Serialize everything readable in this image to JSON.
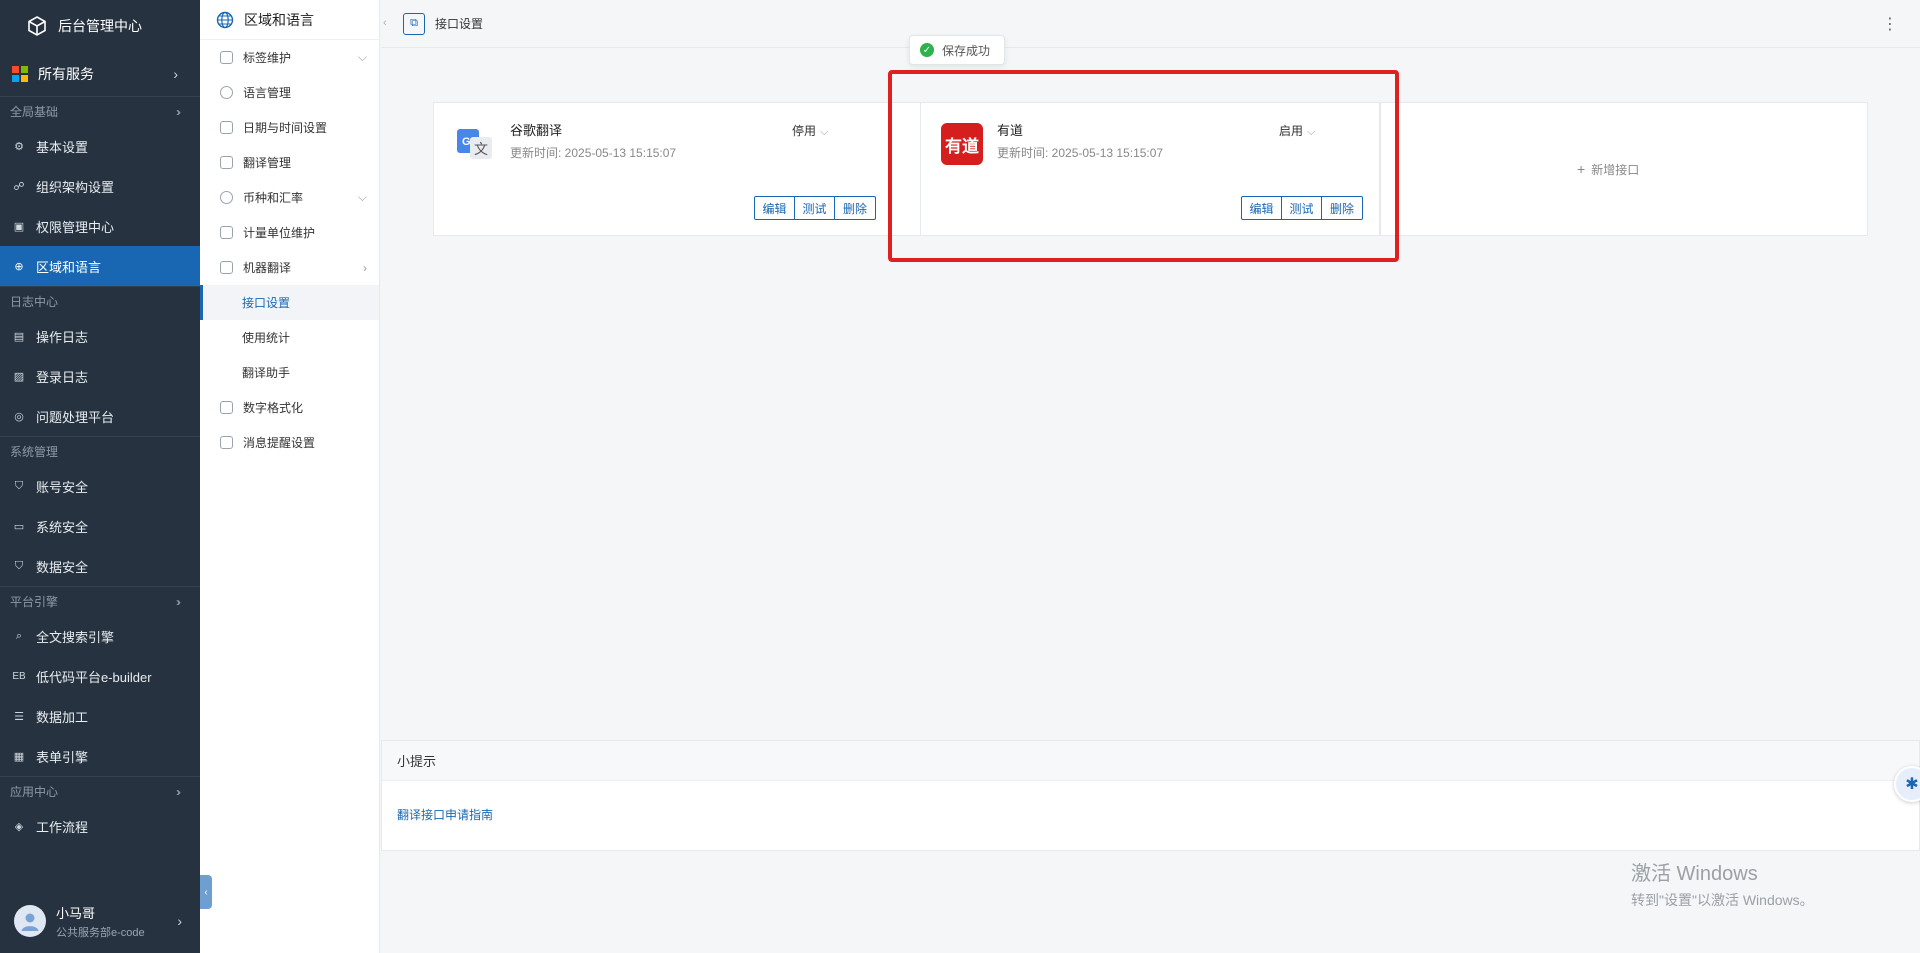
{
  "app": {
    "title": "后台管理中心"
  },
  "sidebar": {
    "all_services": "所有服务",
    "groups": [
      {
        "label": "全局基础",
        "items": [
          "基本设置",
          "组织架构设置",
          "权限管理中心",
          "区域和语言"
        ]
      },
      {
        "label": "日志中心",
        "items": [
          "操作日志",
          "登录日志",
          "问题处理平台"
        ]
      },
      {
        "label": "系统管理",
        "items": [
          "账号安全",
          "系统安全",
          "数据安全"
        ]
      },
      {
        "label": "平台引擎",
        "items": [
          "全文搜索引擎",
          "低代码平台e-builder",
          "数据加工",
          "表单引擎"
        ]
      },
      {
        "label": "应用中心",
        "items": [
          "工作流程"
        ]
      }
    ],
    "active_item": "区域和语言",
    "eb_prefix": "EB",
    "user": {
      "name": "小马哥",
      "dept": "公共服务部e-code"
    }
  },
  "submenu": {
    "title": "区域和语言",
    "items": [
      "标签维护",
      "语言管理",
      "日期与时间设置",
      "翻译管理",
      "币种和汇率",
      "计量单位维护",
      "机器翻译"
    ],
    "children": [
      "接口设置",
      "使用统计",
      "翻译助手"
    ],
    "tail": [
      "数字格式化",
      "消息提醒设置"
    ],
    "selected": "接口设置"
  },
  "topbar": {
    "title": "接口设置"
  },
  "toast": {
    "text": "保存成功"
  },
  "cards": [
    {
      "name": "谷歌翻译",
      "updated": "更新时间: 2025-05-13 15:15:07",
      "status": "停用",
      "actions": [
        "编辑",
        "测试",
        "删除"
      ]
    },
    {
      "name": "有道",
      "updated": "更新时间: 2025-05-13 15:15:07",
      "status": "启用",
      "logo_text": "有道",
      "actions": [
        "编辑",
        "测试",
        "删除"
      ]
    }
  ],
  "add_interface": "新增接口",
  "tips": {
    "title": "小提示",
    "link": "翻译接口申请指南"
  },
  "watermark": {
    "line1": "激活 Windows",
    "line2": "转到\"设置\"以激活 Windows。"
  },
  "colors": {
    "sidebar_bg": "#26323f",
    "accent": "#1967b2",
    "highlight": "#e02020",
    "success": "#2fb14d",
    "youdao": "#d51f1f"
  }
}
